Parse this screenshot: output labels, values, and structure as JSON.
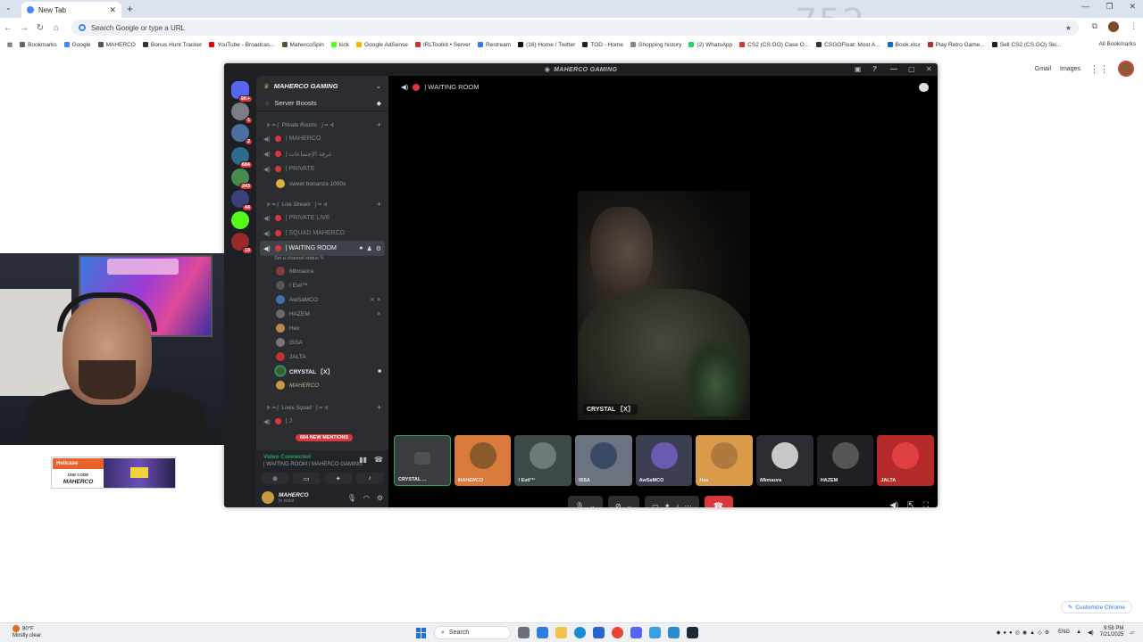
{
  "browser": {
    "tab_title": "New Tab",
    "omnibox_placeholder": "Search Google or type a URL",
    "watermark": "752",
    "bookmarks": [
      {
        "label": "Bookmarks",
        "color": "#666"
      },
      {
        "label": "Google",
        "color": "#4285f4"
      },
      {
        "label": "MAHERCO",
        "color": "#555"
      },
      {
        "label": "Bonus Hunt Tracker",
        "color": "#333"
      },
      {
        "label": "YouTube - Broadcas...",
        "color": "#e00"
      },
      {
        "label": "MahercoSpin",
        "color": "#553"
      },
      {
        "label": "kick",
        "color": "#53fc18"
      },
      {
        "label": "Google AdSense",
        "color": "#f4b400"
      },
      {
        "label": "IRLToolkit • Server",
        "color": "#c33"
      },
      {
        "label": "Restream",
        "color": "#2a7de1"
      },
      {
        "label": "(16) Home / Twitter",
        "color": "#111"
      },
      {
        "label": "TOD - Home",
        "color": "#222"
      },
      {
        "label": "Shopping history",
        "color": "#888"
      },
      {
        "label": "(2) WhatsApp",
        "color": "#25d366"
      },
      {
        "label": "CS2 (CS:GO) Case O...",
        "color": "#d33"
      },
      {
        "label": "CSGOFloat: Most A...",
        "color": "#333"
      },
      {
        "label": "Book.xlsx",
        "color": "#0b6fd0"
      },
      {
        "label": "Play Retro Game...",
        "color": "#a33"
      },
      {
        "label": "Sell CS2 (CS:GO) Ski...",
        "color": "#222"
      }
    ],
    "all_bookmarks": "All Bookmarks",
    "gmail": "Gmail",
    "images": "Images",
    "customize": "Customize Chrome"
  },
  "discord": {
    "title": "MAHERCO GAMING",
    "server_name": "MAHERCO GAMING",
    "server_boosts": "Server Boosts",
    "guild_badges": [
      "9K+",
      "1",
      "2",
      "684",
      "243",
      "44",
      "",
      "10"
    ],
    "categories": [
      {
        "label": "ˑ ⊱ ━ { ˑPrivate Rooms ˑ } ━ ⊰ ˑ",
        "channels": [
          {
            "name": "| MAHERCO"
          },
          {
            "name": "| غرفة الإجتماعات"
          },
          {
            "name": "| PRIVATE"
          }
        ],
        "members": [
          {
            "name": "sweet bonanza 1000x"
          }
        ]
      },
      {
        "label": "ˑ ⊱ ━ { ˑLive Stream ˑ } ━ ⊰ ˑ",
        "channels": [
          {
            "name": "| PRIVATE LIVE"
          },
          {
            "name": "| SQUAD MAHERCO"
          }
        ]
      }
    ],
    "active_channel": {
      "name": "| WAITING ROOM",
      "status_hint": "Set a channel status ✎",
      "members": [
        {
          "name": "Mkmaora",
          "color": "#8b3a3a"
        },
        {
          "name": "! Evil™",
          "color": "#555"
        },
        {
          "name": "AwSaMCO",
          "color": "#4b6bb0"
        },
        {
          "name": "HAZEM",
          "color": "#6a6a6a"
        },
        {
          "name": "Hex",
          "color": "#c08a3e"
        },
        {
          "name": "ISSA",
          "color": "#777"
        },
        {
          "name": "JALTA",
          "color": "#c23030"
        },
        {
          "name": "CRYSTAL 〖X〗",
          "color": "#3d5a3a"
        },
        {
          "name": "MAHERCO",
          "color": "#c99a3f"
        }
      ]
    },
    "third_category": "ˑ ⊱ ━ { ˑLives Squad ˑ } ━ ⊰ ˑ",
    "partial_channel": "| J",
    "mentions": "684 NEW MENTIONS",
    "voice_status": "Video Connected",
    "voice_channel": "| WAITING ROOM / MAHERCO GAMING",
    "user_name": "MAHERCO",
    "user_status": "In voice",
    "stage_channel": "| WAITING ROOM",
    "video_label": "CRYSTAL 〖X〗",
    "tiles": [
      {
        "name": "CRYSTAL ...",
        "bg": "#3a3c41",
        "face": "#4e5058"
      },
      {
        "name": "MAHERCO",
        "bg": "#d97a3a",
        "face": "#8a5a2a"
      },
      {
        "name": "! Evil™",
        "bg": "#3d4a4a",
        "face": "#6b7a7a"
      },
      {
        "name": "ISSA",
        "bg": "#6b7380",
        "face": "#3a4a66"
      },
      {
        "name": "AwSaMCO",
        "bg": "#3c3f52",
        "face": "#6b5ab0"
      },
      {
        "name": "Hex",
        "bg": "#d99a4a",
        "face": "#b07a3e"
      },
      {
        "name": "Mkmaora",
        "bg": "#2a2c31",
        "face": "#c8c8c8"
      },
      {
        "name": "HAZEM",
        "bg": "#1f2024",
        "face": "#555"
      },
      {
        "name": "JALTA",
        "bg": "#b52a2a",
        "face": "#e04040"
      }
    ]
  },
  "sponsor": {
    "brand": "Hellcase",
    "code_label": "USE CODE",
    "code": "MAHERCO"
  },
  "taskbar": {
    "temp": "80°F",
    "weather": "Mostly clear",
    "search": "Search",
    "lang": "ENG",
    "time": "9:58 PM",
    "date": "7/21/2025"
  }
}
